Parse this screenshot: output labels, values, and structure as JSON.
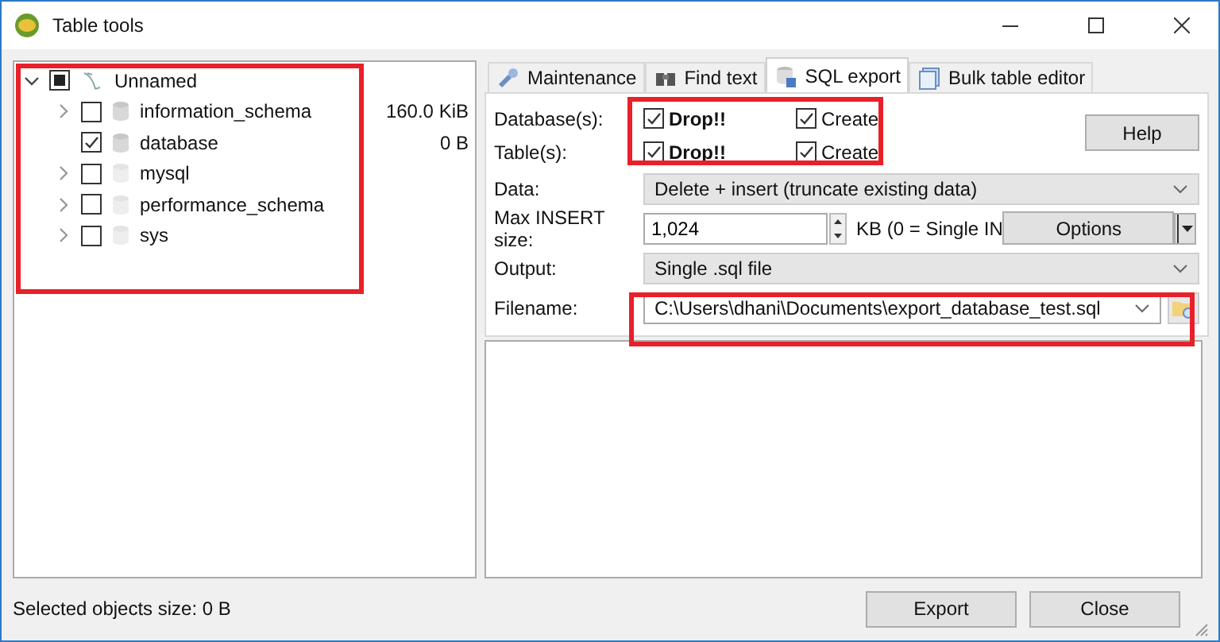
{
  "window": {
    "title": "Table tools"
  },
  "tree": {
    "label": "Unnamed",
    "expanded": true,
    "checked": false,
    "mixed": true,
    "children": [
      {
        "label": "information_schema",
        "size": "160.0 KiB",
        "expandable": true,
        "checked": false,
        "active": true
      },
      {
        "label": "database",
        "size": "0 B",
        "expandable": false,
        "checked": true,
        "active": true
      },
      {
        "label": "mysql",
        "expandable": true,
        "checked": false,
        "active": false
      },
      {
        "label": "performance_schema",
        "expandable": true,
        "checked": false,
        "active": false
      },
      {
        "label": "sys",
        "expandable": true,
        "checked": false,
        "active": false
      }
    ]
  },
  "tabs": [
    {
      "label": "Maintenance",
      "selected": false
    },
    {
      "label": "Find text",
      "selected": false
    },
    {
      "label": "SQL export",
      "selected": true
    },
    {
      "label": "Bulk table editor",
      "selected": false
    }
  ],
  "export": {
    "options": [
      {
        "label": "Database(s):",
        "drop": {
          "label": "Drop!!",
          "checked": true
        },
        "create": {
          "label": "Create",
          "checked": true
        }
      },
      {
        "label": "Table(s):",
        "drop": {
          "label": "Drop!!",
          "checked": true
        },
        "create": {
          "label": "Create",
          "checked": true
        }
      }
    ],
    "help_button": "Help",
    "data": {
      "label": "Data:",
      "value": "Delete + insert (truncate existing data)"
    },
    "max_insert": {
      "label": "Max INSERT size:",
      "value": "1,024",
      "hint": "KB (0 = Single IN",
      "options_button": "Options"
    },
    "output": {
      "label": "Output:",
      "value": "Single .sql file"
    },
    "filename": {
      "label": "Filename:",
      "value": "C:\\Users\\dhani\\Documents\\export_database_test.sql"
    }
  },
  "status_bar": "Selected objects size: 0 B",
  "buttons": [
    "Export",
    "Close"
  ]
}
